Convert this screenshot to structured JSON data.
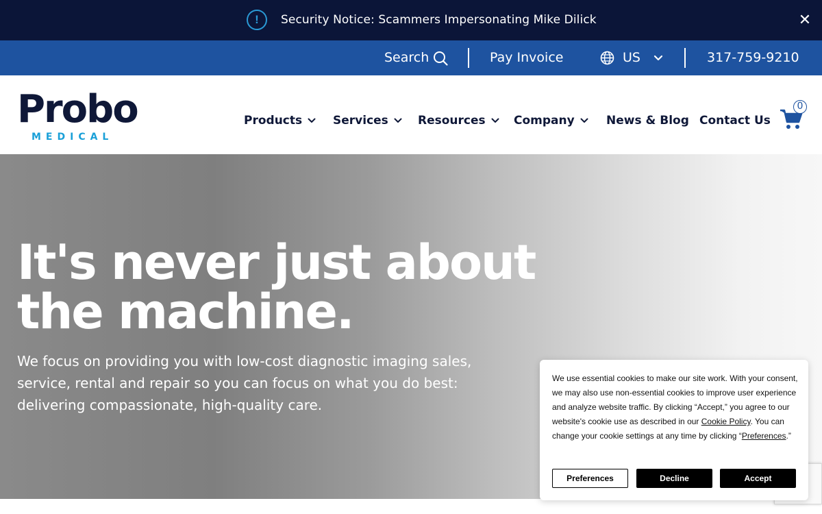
{
  "notice": {
    "text": "Security Notice: Scammers Impersonating Mike Dilick",
    "alert_symbol": "!",
    "close_symbol": "✕"
  },
  "utility": {
    "search_label": "Search",
    "pay_invoice_label": "Pay Invoice",
    "region_label": "US",
    "phone": "317-759-9210",
    "icons": [
      "search-icon",
      "globe-icon",
      "chevron-down-icon"
    ]
  },
  "logo": {
    "name": "Probo",
    "tagline": "MEDICAL"
  },
  "nav": {
    "items": [
      {
        "label": "Products",
        "has_dropdown": true
      },
      {
        "label": "Services",
        "has_dropdown": true
      },
      {
        "label": "Resources",
        "has_dropdown": true
      },
      {
        "label": "Company",
        "has_dropdown": true
      },
      {
        "label": "News & Blog",
        "has_dropdown": false
      },
      {
        "label": "Contact Us",
        "has_dropdown": false
      }
    ],
    "cart_count": "0"
  },
  "hero": {
    "headline_line1": "It's never just about",
    "headline_line2": "the machine.",
    "body_line1": "We focus on providing you with low-cost diagnostic imaging sales,",
    "body_line2": "service, rental and repair so you can focus on what you do best:",
    "body_line3": "delivering compassionate, high-quality care."
  },
  "cookie": {
    "text_part1": "We use essential cookies to make our site work. With your consent, we may also use non-essential cookies to improve user experience and analyze website traffic. By clicking “Accept,” you agree to our website's cookie use as described in our ",
    "cookie_policy_link": "Cookie Policy",
    "text_part2": ". You can change your cookie settings at any time by clicking “",
    "preferences_link": "Preferences",
    "text_part3": ".”",
    "preferences_button": "Preferences",
    "decline_button": "Decline",
    "accept_button": "Accept"
  },
  "colors": {
    "notice_bg": "#0b1538",
    "utility_bg": "#1e53a0",
    "brand_dark": "#0f1838",
    "brand_cyan": "#1aa0d8"
  }
}
